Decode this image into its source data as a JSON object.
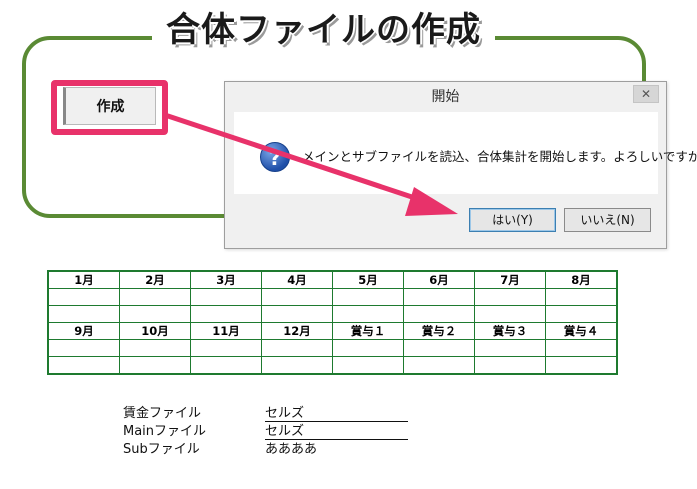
{
  "header": {
    "title": "合体ファイルの作成"
  },
  "create_button": {
    "label": "作成"
  },
  "dialog": {
    "title": "開始",
    "close_glyph": "✕",
    "icon_glyph": "?",
    "message": "メインとサブファイルを読込、合体集計を開始します。よろしいですか？",
    "yes_label": "はい(Y)",
    "no_label": "いいえ(N)"
  },
  "table": {
    "row1_headers": [
      "1月",
      "2月",
      "3月",
      "4月",
      "5月",
      "6月",
      "7月",
      "8月"
    ],
    "row2_headers": [
      "9月",
      "10月",
      "11月",
      "12月",
      "賞与１",
      "賞与２",
      "賞与３",
      "賞与４"
    ]
  },
  "files": [
    {
      "label": "賃金ファイル",
      "value": "セルズ"
    },
    {
      "label": "Mainファイル",
      "value": "セルズ"
    },
    {
      "label": "Subファイル",
      "value": "ああああ"
    }
  ],
  "colors": {
    "frame": "#5a8a34",
    "highlight": "#e8326a",
    "table_border": "#1e7a2f"
  },
  "icons": {
    "dialog_icon": "question-icon",
    "annotation": "arrow-pointer-icon"
  }
}
